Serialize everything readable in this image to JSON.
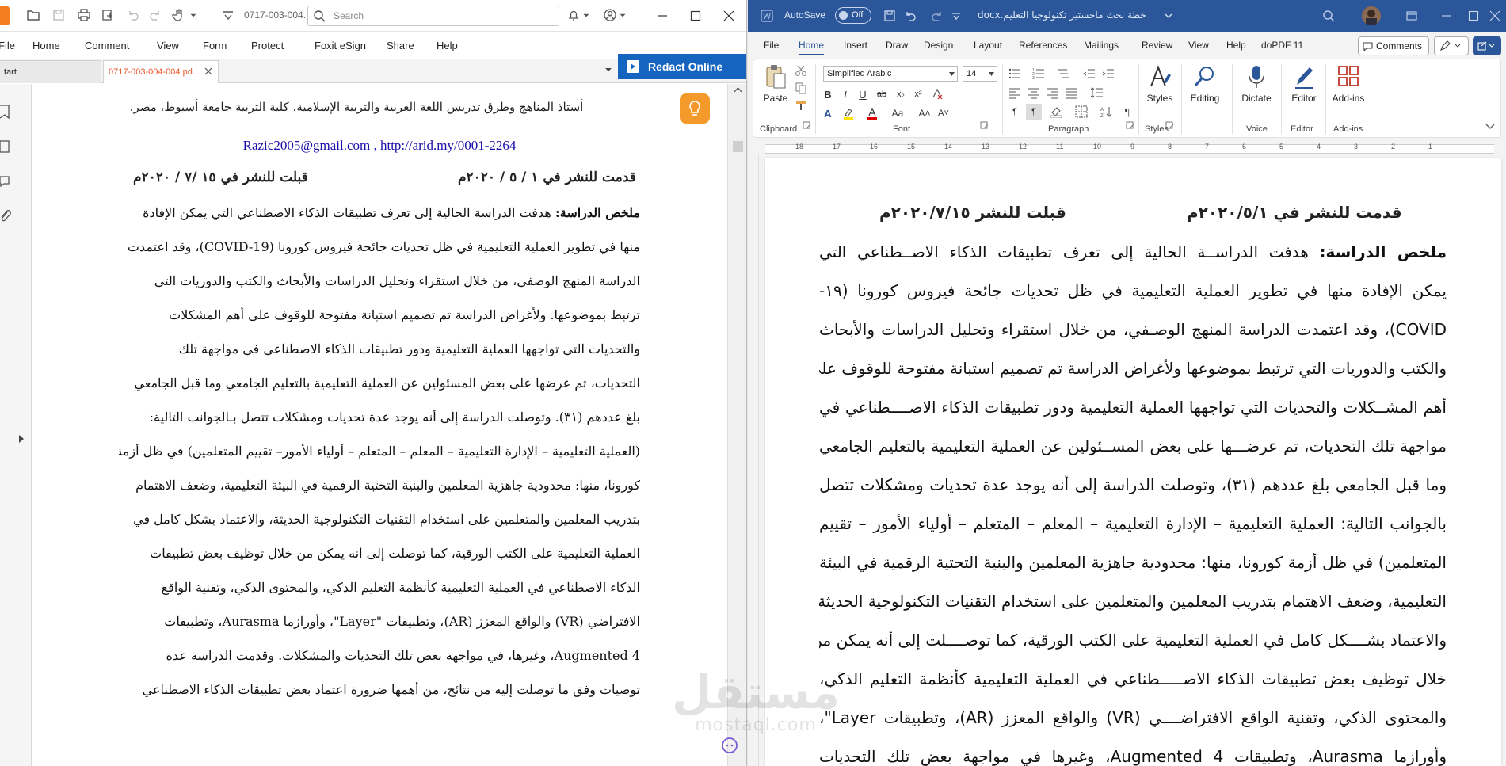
{
  "foxit": {
    "filename_short": "0717-003-004...",
    "search_placeholder": "Search",
    "menu": [
      "File",
      "Home",
      "Comment",
      "View",
      "Form",
      "Protect",
      "Foxit eSign",
      "Share",
      "Help"
    ],
    "tabs": [
      {
        "label": "tart"
      },
      {
        "label": "0717-003-004-004.pd..."
      }
    ],
    "redact_label": "Redact Online",
    "accent": "#f47d20",
    "redact_color": "#1565c0",
    "page": {
      "affiliation": "أستاذ المناهج وطرق تدريس اللغة العربية والتربية الإسلامية، كلية التربية جامعة أسيوط، مصر.",
      "email": "Razic2005@gmail.com",
      "links_sep": " , ",
      "url": "http://arid.my/0001-2264",
      "submitted": "قدمت للنشر في ١ / ٥ / ٢٠٢٠م",
      "accepted": "قبلت للنشر في ١٥ /٧ / ٢٠٢٠م",
      "abstract_label": "ملخص الدراسة:",
      "abstract_lines": [
        " هدفت الدراسة الحالية إلى تعرف تطبيقات الذكاء الاصطناعي التي يمكن الإفادة",
        "منها في تطوير العملية التعليمية في ظل تحديات جائحة فيروس كورونا (COVID-19)، وقد اعتمدت",
        "الدراسة المنهج الوصفي، من خلال استقراء وتحليل الدراسات والأبحاث والكتب والدوريات التي",
        "ترتبط بموضوعها. ولأغراض الدراسة تم تصميم استبانة مفتوحة للوقوف على أهم المشكلات",
        "والتحديات التي تواجهها العملية التعليمية ودور تطبيقات الذكاء الاصطناعي في مواجهة تلك",
        "التحديات، تم عرضها على بعض المسئولين عن العملية التعليمية بالتعليم الجامعي وما قبل الجامعي",
        "بلغ عددهم (٣١). وتوصلت الدراسة إلى أنه يوجد عدة تحديات ومشكلات تتصل بـالجوانب التالية:",
        "(العملية التعليمية – الإدارة التعليمية – المعلم – المتعلم – أولياء الأمور– تقييم المتعلمين) في ظل أزمة",
        "كورونا، منها: محدودية جاهزية المعلمين والبنية التحتية الرقمية في البيئة التعليمية، وضعف الاهتمام",
        "بتدريب المعلمين والمتعلمين على استخدام التقنيات التكنولوجية الحديثة، والاعتماد بشكل كامل في",
        "العملية التعليمية على الكتب الورقية، كما توصلت إلى أنه يمكن من خلال توظيف بعض تطبيقات",
        "الذكاء الاصطناعي في العملية التعليمية كأنظمة التعليم الذكي، والمحتوى الذكي، وتقنية الواقع",
        "الافتراضي (VR) والواقع المعزز (AR)، وتطبيقات \"Layer\"، وأورازما Aurasma، وتطبيقات",
        "Augmented 4، وغيرها، في مواجهة بعض تلك التحديات والمشكلات. وقدمت الدراسة عدة",
        "توصيات وفق ما توصلت إليه من نتائج، من أهمها ضرورة اعتماد بعض تطبيقات الذكاء الاصطناعي"
      ]
    }
  },
  "word": {
    "autosave_label": "AutoSave",
    "autosave_state": "Off",
    "doc_name": "خطة بحث ماجستير تكنولوجيا التعليم.docx",
    "brand_color": "#2b579a",
    "menu": [
      "File",
      "Home",
      "Insert",
      "Draw",
      "Design",
      "Layout",
      "References",
      "Mailings",
      "Review",
      "View",
      "Help",
      "doPDF 11"
    ],
    "comments_label": "Comments",
    "ribbon": {
      "paste": "Paste",
      "clipboard": "Clipboard",
      "font_name": "Simplified Arabic",
      "font_size": "14",
      "font": "Font",
      "paragraph": "Paragraph",
      "styles": "Styles",
      "styles_group": "Styles",
      "editing": "Editing",
      "dictate": "Dictate",
      "voice": "Voice",
      "editor": "Editor",
      "editor_group": "Editor",
      "addins": "Add-ins",
      "addins_group": "Add-ins"
    },
    "ruler_numbers": [
      "18",
      "17",
      "16",
      "15",
      "14",
      "13",
      "12",
      "11",
      "10",
      "9",
      "8",
      "7",
      "6",
      "5",
      "4",
      "3",
      "2",
      "1"
    ],
    "page": {
      "submitted": "قدمت للنشر في ٢٠٢٠/٥/١م",
      "accepted": "قبلت للنشر ٢٠٢٠/٧/١٥م",
      "abstract_label": "ملخص الدراسة:",
      "abstract_lines": [
        " هدفت الدراســة الحالية إلى تعرف تطبيقات الذكاء الاصــطناعي التي",
        "يمكن الإفادة منها في تطوير العملية التعليمية في ظل تحديات جائحة فيروس كورونا (١٩-",
        "COVID)، وقد اعتمدت الدراسة المنهج الوصـفي، من خلال استقراء وتحليل الدراسات والأبحاث",
        "والكتب والدوريات التي ترتبط بموضوعها ولأغراض الدراسة تم تصميم استبانة مفتوحة للوقوف على",
        "أهم المشــكلات والتحديات التي تواجهها العملية التعليمية ودور تطبيقات الذكاء الاصــــطناعي في",
        "مواجهة تلك التحديات، تم عرضـــها على بعض المســئولين عن العملية التعليمية بالتعليم الجامعي",
        "وما قبل الجامعي بلغ عددهم (٣١)، وتوصلت الدراسة إلى أنه يوجد عدة تحديات ومشكلات تتصل",
        "بالجوانب التالية: العملية التعليمية – الإدارة التعليمية – المعلم – المتعلم – أولياء الأمور – تقييم",
        "المتعلمين) في ظل أزمة كورونا، منها: محدودية جاهزية المعلمين والبنية التحتية الرقمية في البيئة",
        "التعليمية، وضعف الاهتمام بتدريب المعلمين والمتعلمين على استخدام التقنيات التكنولوجية الحديثة،",
        "والاعتماد بشــــكل كامل في العملية التعليمية على الكتب الورقية، كما توصــــلت إلى أنه يمكن من",
        "خلال توظيف بعض تطبيقات الذكاء الاصـــــطناعي في العملية التعليمية كأنظمة التعليم الذكي،",
        "والمحتوى الذكي، وتقنية الواقع الافتراضــــي (VR) والواقع المعزز (AR)، وتطبيقات Layer\"،",
        "وأورازما Aurasma، وتطبيقات Augmented 4، وغيرها في مواجهة بعض تلك التحديات"
      ]
    }
  },
  "watermark": {
    "arabic": "مستقل",
    "latin": "mostaql.com"
  }
}
